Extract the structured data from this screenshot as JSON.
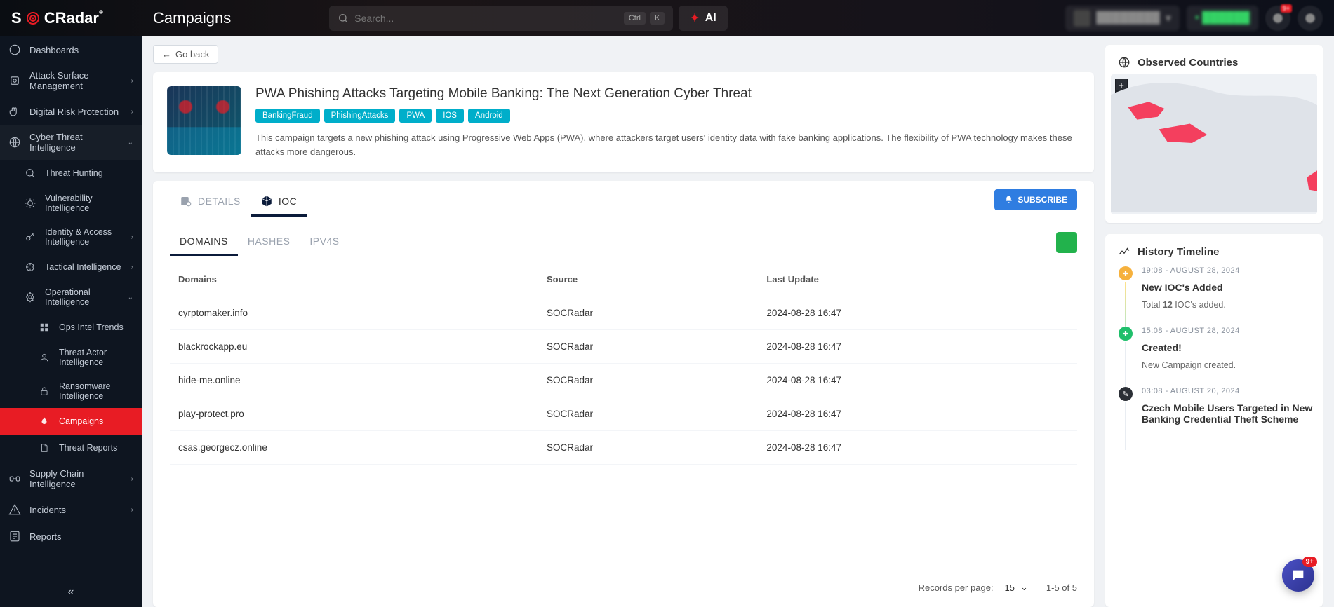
{
  "header": {
    "brand_prefix": "S",
    "brand_mid": "O",
    "brand_suffix": "CRadar",
    "page_title": "Campaigns",
    "search_placeholder": "Search...",
    "kbd1": "Ctrl",
    "kbd2": "K",
    "ai_label": "AI",
    "notif_badge": "9+"
  },
  "sidebar": {
    "items": [
      {
        "label": "Dashboards"
      },
      {
        "label": "Attack Surface Management",
        "chev": ">"
      },
      {
        "label": "Digital Risk Protection",
        "chev": ">"
      },
      {
        "label": "Cyber Threat Intelligence",
        "chev": "v"
      },
      {
        "label": "Threat Hunting"
      },
      {
        "label": "Vulnerability Intelligence"
      },
      {
        "label": "Identity & Access Intelligence",
        "chev": ">"
      },
      {
        "label": "Tactical Intelligence",
        "chev": ">"
      },
      {
        "label": "Operational Intelligence",
        "chev": "v"
      },
      {
        "label": "Ops Intel Trends"
      },
      {
        "label": "Threat Actor Intelligence"
      },
      {
        "label": "Ransomware Intelligence"
      },
      {
        "label": "Campaigns"
      },
      {
        "label": "Threat Reports"
      },
      {
        "label": "Supply Chain Intelligence",
        "chev": ">"
      },
      {
        "label": "Incidents",
        "chev": ">"
      },
      {
        "label": "Reports"
      }
    ]
  },
  "go_back": "Go back",
  "campaign": {
    "title": "PWA Phishing Attacks Targeting Mobile Banking: The Next Generation Cyber Threat",
    "tags": [
      "BankingFraud",
      "PhishingAttacks",
      "PWA",
      "IOS",
      "Android"
    ],
    "description": "This campaign targets a new phishing attack using Progressive Web Apps (PWA), where attackers target users' identity data with fake banking applications. The flexibility of PWA technology makes these attacks more dangerous."
  },
  "tabs": {
    "details": "DETAILS",
    "ioc": "IOC"
  },
  "subscribe": "SUBSCRIBE",
  "subtabs": {
    "domains": "DOMAINS",
    "hashes": "HASHES",
    "ipv4s": "IPV4S"
  },
  "table": {
    "headers": {
      "domains": "Domains",
      "source": "Source",
      "last_update": "Last Update"
    },
    "rows": [
      {
        "d": "cyrptomaker.info",
        "s": "SOCRadar",
        "u": "2024-08-28 16:47"
      },
      {
        "d": "blackrockapp.eu",
        "s": "SOCRadar",
        "u": "2024-08-28 16:47"
      },
      {
        "d": "hide-me.online",
        "s": "SOCRadar",
        "u": "2024-08-28 16:47"
      },
      {
        "d": "play-protect.pro",
        "s": "SOCRadar",
        "u": "2024-08-28 16:47"
      },
      {
        "d": "csas.georgecz.online",
        "s": "SOCRadar",
        "u": "2024-08-28 16:47"
      }
    ]
  },
  "pager": {
    "rpp_label": "Records per page:",
    "rpp_value": "15",
    "range": "1-5 of 5"
  },
  "observed": {
    "title": "Observed Countries",
    "zoom_in": "+",
    "zoom_out": "−"
  },
  "history": {
    "title": "History Timeline",
    "items": [
      {
        "time": "19:08 - AUGUST 28, 2024",
        "title": "New IOC's Added",
        "body_pre": "Total ",
        "body_bold": "12",
        "body_post": " IOC's added."
      },
      {
        "time": "15:08 - AUGUST 28, 2024",
        "title": "Created!",
        "body": "New Campaign created."
      },
      {
        "time": "03:08 - AUGUST 20, 2024",
        "title": "Czech Mobile Users Targeted in New Banking Credential Theft Scheme"
      }
    ]
  },
  "fab_badge": "9+"
}
